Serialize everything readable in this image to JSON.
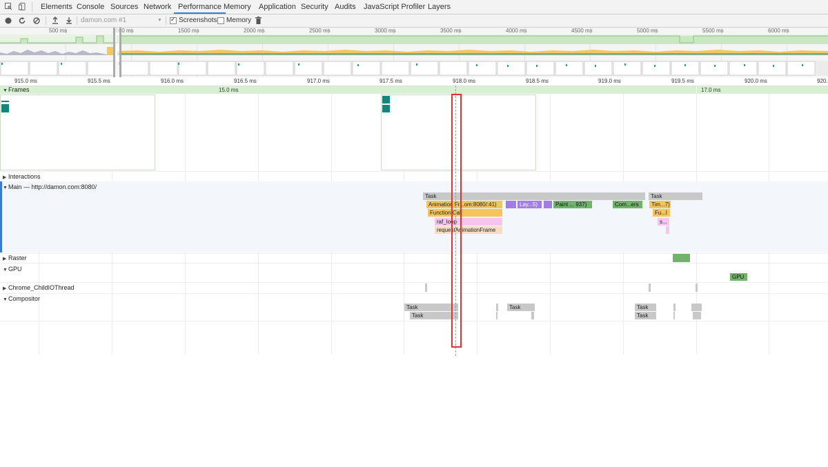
{
  "tabbar": {
    "tabs": [
      {
        "label": "Elements"
      },
      {
        "label": "Console"
      },
      {
        "label": "Sources"
      },
      {
        "label": "Network"
      },
      {
        "label": "Performance"
      },
      {
        "label": "Memory"
      },
      {
        "label": "Application"
      },
      {
        "label": "Security"
      },
      {
        "label": "Audits"
      },
      {
        "label": "JavaScript Profiler"
      },
      {
        "label": "Layers"
      }
    ],
    "active_tab": "Performance"
  },
  "toolbar": {
    "profile_select": "damon.com #1",
    "screenshots_label": "Screenshots",
    "screenshots_checked": true,
    "memory_label": "Memory",
    "memory_checked": false
  },
  "overview": {
    "ticks": [
      "500 ms",
      "1000 ms",
      "1500 ms",
      "2000 ms",
      "2500 ms",
      "3000 ms",
      "3500 ms",
      "4000 ms",
      "4500 ms",
      "5000 ms",
      "5500 ms",
      "6000 ms"
    ]
  },
  "ruler": {
    "ticks": [
      "915.0 ms",
      "915.5 ms",
      "916.0 ms",
      "916.5 ms",
      "917.0 ms",
      "917.5 ms",
      "918.0 ms",
      "918.5 ms",
      "919.0 ms",
      "919.5 ms",
      "920.0 ms",
      "920."
    ]
  },
  "frames": {
    "label": "Frames",
    "durations": [
      "15.0 ms",
      "17.0 ms"
    ]
  },
  "tracks": {
    "interactions": "Interactions",
    "main": "Main — http://damon.com:8080/",
    "raster": "Raster",
    "gpu": "GPU",
    "childio": "Chrome_ChildIOThread",
    "compositor": "Compositor"
  },
  "main_events": {
    "task1": "Task",
    "task2": "Task",
    "animation": "Animation Fr...om:8080/:41)",
    "layout": "Lay...5)",
    "paint": "Paint ... 937)",
    "composite": "Com...ers",
    "timer": "Tim...7)",
    "function_call": "Function Call",
    "fu": "Fu...l",
    "raf_loop": "raf_loop",
    "s": "s...",
    "request_af": "requestAnimationFrame"
  },
  "gpu_event": "GPU",
  "compositor_events": {
    "task_a": "Task",
    "task_b": "Task",
    "task_c": "Task",
    "task_d": "Task",
    "task_e": "Task"
  }
}
